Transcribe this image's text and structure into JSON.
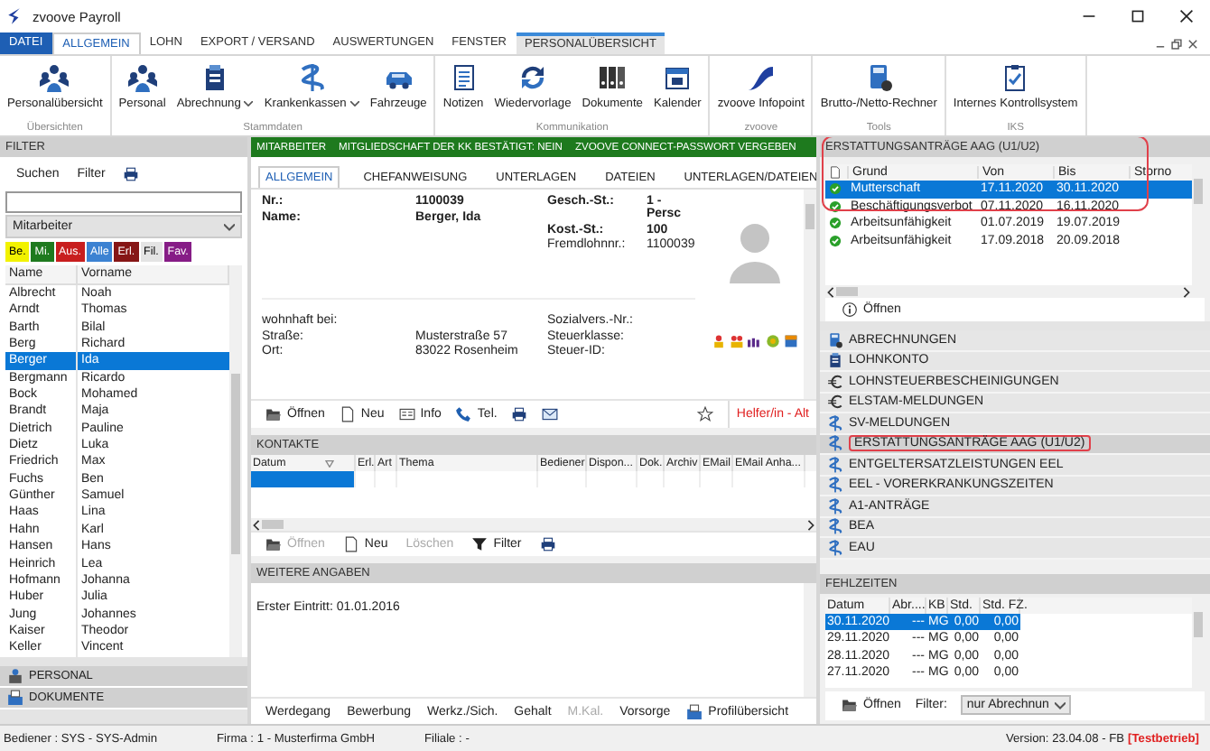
{
  "window": {
    "title": "zvoove Payroll"
  },
  "menu": [
    {
      "label": "DATEI",
      "kind": "file",
      "selected": false
    },
    {
      "label": "ALLGEMEIN",
      "kind": "tab",
      "selected": true
    },
    {
      "label": "LOHN",
      "kind": "tab",
      "selected": false
    },
    {
      "label": "EXPORT / VERSAND",
      "kind": "tab",
      "selected": false
    },
    {
      "label": "AUSWERTUNGEN",
      "kind": "tab",
      "selected": false
    },
    {
      "label": "FENSTER",
      "kind": "tab",
      "selected": false
    },
    {
      "label": "PERSONALÜBERSICHT",
      "kind": "context",
      "selected": false
    }
  ],
  "ribbon": [
    {
      "group": "Übersichten",
      "buttons": [
        {
          "label": "Personalübersicht",
          "menu": false
        }
      ]
    },
    {
      "group": "Stammdaten",
      "buttons": [
        {
          "label": "Personal",
          "menu": false
        },
        {
          "label": "Abrechnung",
          "menu": true
        },
        {
          "label": "Krankenkassen",
          "menu": true
        },
        {
          "label": "Fahrzeuge",
          "menu": false
        }
      ]
    },
    {
      "group": "Kommunikation",
      "buttons": [
        {
          "label": "Notizen",
          "menu": false
        },
        {
          "label": "Wiedervorlage",
          "menu": false
        },
        {
          "label": "Dokumente",
          "menu": false
        },
        {
          "label": "Kalender",
          "menu": false
        }
      ]
    },
    {
      "group": "zvoove",
      "buttons": [
        {
          "label": "zvoove Infopoint",
          "menu": false
        }
      ]
    },
    {
      "group": "Tools",
      "buttons": [
        {
          "label": "Brutto-/Netto-Rechner",
          "menu": false
        }
      ]
    },
    {
      "group": "IKS",
      "buttons": [
        {
          "label": "Internes Kontrollsystem",
          "menu": false
        }
      ]
    }
  ],
  "filter": {
    "title": "FILTER",
    "actions": [
      "Suchen",
      "Filter"
    ],
    "scope": "Mitarbeiter",
    "chips": [
      {
        "label": "Be.",
        "color": "#f2f200"
      },
      {
        "label": "Mi.",
        "color": "#1f7a1f"
      },
      {
        "label": "Aus.",
        "color": "#c81e1e"
      },
      {
        "label": "Alle",
        "color": "#3c82d2"
      },
      {
        "label": "Erl.",
        "color": "#861616"
      },
      {
        "label": "Fil.",
        "color": "#e4e4e4"
      },
      {
        "label": "Fav.",
        "color": "#861c86"
      }
    ],
    "columns": [
      "Name",
      "Vorname"
    ],
    "rows": [
      {
        "name": "Albrecht",
        "first": "Noah",
        "selected": false
      },
      {
        "name": "Arndt",
        "first": "Thomas",
        "selected": false
      },
      {
        "name": "Barth",
        "first": "Bilal",
        "selected": false
      },
      {
        "name": "Berg",
        "first": "Richard",
        "selected": false
      },
      {
        "name": "Berger",
        "first": "Ida",
        "selected": true
      },
      {
        "name": "Bergmann",
        "first": "Ricardo",
        "selected": false
      },
      {
        "name": "Bock",
        "first": "Mohamed",
        "selected": false
      },
      {
        "name": "Brandt",
        "first": "Maja",
        "selected": false
      },
      {
        "name": "Dietrich",
        "first": "Pauline",
        "selected": false
      },
      {
        "name": "Dietz",
        "first": "Luka",
        "selected": false
      },
      {
        "name": "Friedrich",
        "first": "Max",
        "selected": false
      },
      {
        "name": "Fuchs",
        "first": "Ben",
        "selected": false
      },
      {
        "name": "Günther",
        "first": "Samuel",
        "selected": false
      },
      {
        "name": "Haas",
        "first": "Lina",
        "selected": false
      },
      {
        "name": "Hahn",
        "first": "Karl",
        "selected": false
      },
      {
        "name": "Hansen",
        "first": "Hans",
        "selected": false
      },
      {
        "name": "Heinrich",
        "first": "Lea",
        "selected": false
      },
      {
        "name": "Hofmann",
        "first": "Johanna",
        "selected": false
      },
      {
        "name": "Huber",
        "first": "Julia",
        "selected": false
      },
      {
        "name": "Jung",
        "first": "Johannes",
        "selected": false
      },
      {
        "name": "Kaiser",
        "first": "Theodor",
        "selected": false
      },
      {
        "name": "Keller",
        "first": "Vincent",
        "selected": false
      }
    ]
  },
  "sections": [
    "PERSONAL",
    "DOKUMENTE"
  ],
  "employee": {
    "banner": [
      "MITARBEITER",
      "MITGLIEDSCHAFT DER KK BESTÄTIGT: NEIN",
      "ZVOOVE CONNECT-PASSWORT VERGEBEN"
    ],
    "tabs": [
      {
        "label": "ALLGEMEIN",
        "selected": true
      },
      {
        "label": "CHEFANWEISUNG",
        "selected": false
      },
      {
        "label": "UNTERLAGEN",
        "selected": false
      },
      {
        "label": "DATEIEN",
        "selected": false
      },
      {
        "label": "UNTERLAGEN/DATEIEN",
        "selected": false
      }
    ],
    "summary_left": [
      {
        "label": "Nr.:",
        "value": "1100039",
        "bold": true
      },
      {
        "label": "Name:",
        "value": "Berger, Ida",
        "bold": true
      }
    ],
    "summary_right": [
      {
        "label": "Gesch.-St.:",
        "value": "1 - Persc",
        "bold": true
      },
      {
        "label": "Kost.-St.:",
        "value": "100",
        "bold": true
      },
      {
        "label": "Fremdlohnnr.:",
        "value": "1100039",
        "bold": false
      }
    ],
    "address_heading": "wohnhaft bei:",
    "address": [
      {
        "label": "Straße:",
        "value": "Musterstraße 57"
      },
      {
        "label": "Ort:",
        "value": "83022 Rosenheim"
      }
    ],
    "insurance": [
      "Sozialvers.-Nr.:",
      "Steuerklasse:",
      "Steuer-ID:"
    ],
    "toolbar": [
      "Öffnen",
      "Neu",
      "Info",
      "Tel."
    ],
    "helper": "Helfer/in - Alt"
  },
  "contacts": {
    "title": "KONTAKTE",
    "columns": [
      "Datum",
      "Erl.",
      "Art",
      "Thema",
      "Bediener",
      "Dispon...",
      "Dok.",
      "Archiv",
      "EMail",
      "EMail Anha..."
    ],
    "rows": [
      {
        "selected": true
      }
    ],
    "toolbar": [
      {
        "label": "Öffnen",
        "disabled": true
      },
      {
        "label": "Neu",
        "disabled": false
      },
      {
        "label": "Löschen",
        "disabled": true
      },
      {
        "label": "Filter",
        "disabled": false
      }
    ]
  },
  "more": {
    "title": "WEITERE ANGABEN",
    "text": "Erster Eintritt: 01.01.2016",
    "tabs": [
      {
        "label": "Werdegang",
        "disabled": false
      },
      {
        "label": "Bewerbung",
        "disabled": false
      },
      {
        "label": "Werkz./Sich.",
        "disabled": false
      },
      {
        "label": "Gehalt",
        "disabled": false
      },
      {
        "label": "M.Kal.",
        "disabled": true
      },
      {
        "label": "Vorsorge",
        "disabled": false
      },
      {
        "label": "Profilübersicht",
        "disabled": false
      }
    ]
  },
  "refunds": {
    "title": "ERSTATTUNGSANTRÄGE AAG (U1/U2)",
    "highlighted": true,
    "columns": [
      "Grund",
      "Von",
      "Bis",
      "Storno"
    ],
    "rows": [
      {
        "reason": "Mutterschaft",
        "from": "17.11.2020",
        "to": "30.11.2020",
        "selected": true
      },
      {
        "reason": "Beschäftigungsverbot",
        "from": "07.11.2020",
        "to": "16.11.2020",
        "selected": false
      },
      {
        "reason": "Arbeitsunfähigkeit",
        "from": "01.07.2019",
        "to": "19.07.2019",
        "selected": false
      },
      {
        "reason": "Arbeitsunfähigkeit",
        "from": "17.09.2018",
        "to": "20.09.2018",
        "selected": false
      }
    ],
    "action": "Öffnen"
  },
  "nav": [
    {
      "label": "ABRECHNUNGEN",
      "selected": false,
      "highlighted": false
    },
    {
      "label": "LOHNKONTO",
      "selected": false,
      "highlighted": false
    },
    {
      "label": "LOHNSTEUERBESCHEINIGUNGEN",
      "selected": false,
      "highlighted": false
    },
    {
      "label": "ELSTAM-MELDUNGEN",
      "selected": false,
      "highlighted": false
    },
    {
      "label": "SV-MELDUNGEN",
      "selected": false,
      "highlighted": false
    },
    {
      "label": "ERSTATTUNGSANTRÄGE AAG (U1/U2)",
      "selected": true,
      "highlighted": true
    },
    {
      "label": "ENTGELTERSATZLEISTUNGEN EEL",
      "selected": false,
      "highlighted": false
    },
    {
      "label": "EEL - VORERKRANKUNGSZEITEN",
      "selected": false,
      "highlighted": false
    },
    {
      "label": "A1-ANTRÄGE",
      "selected": false,
      "highlighted": false
    },
    {
      "label": "BEA",
      "selected": false,
      "highlighted": false
    },
    {
      "label": "EAU",
      "selected": false,
      "highlighted": false
    }
  ],
  "absences": {
    "title": "FEHLZEITEN",
    "columns": [
      "Datum",
      "Abr....",
      "KB",
      "Std.",
      "Std. FZ."
    ],
    "rows": [
      {
        "cells": [
          "30.11.2020",
          "---",
          "MG",
          "0,00",
          "0,00"
        ],
        "selected": true
      },
      {
        "cells": [
          "29.11.2020",
          "---",
          "MG",
          "0,00",
          "0,00"
        ],
        "selected": false
      },
      {
        "cells": [
          "28.11.2020",
          "---",
          "MG",
          "0,00",
          "0,00"
        ],
        "selected": false
      },
      {
        "cells": [
          "27.11.2020",
          "---",
          "MG",
          "0,00",
          "0,00"
        ],
        "selected": false
      }
    ],
    "action": "Öffnen",
    "filter_label": "Filter:",
    "filter_value": "nur Abrechnun"
  },
  "status": {
    "user": "Bediener : SYS - SYS-Admin",
    "company": "Firma : 1 - Musterfirma GmbH",
    "branch": "Filiale : -",
    "version": "Version: 23.04.08 - FB",
    "mode": "[Testbetrieb]"
  }
}
